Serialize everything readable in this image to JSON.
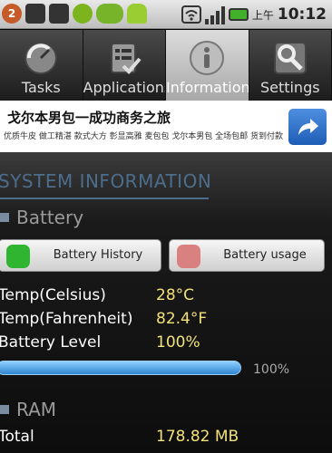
{
  "status_bar": {
    "badge_count": "2",
    "ampm": "上午",
    "time": "10:12",
    "icons": [
      "notification-count-icon",
      "usb-icon",
      "android-robot-icon",
      "refresh-icon",
      "pea-icon",
      "android-icon",
      "wifi-icon",
      "signal-icon",
      "battery-icon"
    ]
  },
  "tabs": [
    {
      "label": "Tasks",
      "icon": "tasks-icon",
      "active": false
    },
    {
      "label": "Applications",
      "icon": "applications-icon",
      "active": false
    },
    {
      "label": "Information",
      "icon": "info-icon",
      "active": true
    },
    {
      "label": "Settings",
      "icon": "settings-icon",
      "active": false
    }
  ],
  "ad": {
    "title": "戈尔本男包一成功商务之旅",
    "subtitle": "优质牛皮 做工精湛 款式大方 彰显高雅 麦包包 戈尔本男包 全场包邮 货到付款",
    "button_icon": "share-arrow-icon"
  },
  "system_info": {
    "title": "SYSTEM INFORMATION",
    "battery": {
      "section_label": "Battery",
      "history_button": "Battery History",
      "usage_button": "Battery usage",
      "rows": [
        {
          "label": "Temp(Celsius)",
          "value": "28°C"
        },
        {
          "label": "Temp(Fahrenheit)",
          "value": "82.4°F"
        },
        {
          "label": "Battery Level",
          "value": "100%"
        }
      ],
      "level_percent": 100,
      "level_text": "100%"
    },
    "ram": {
      "section_label": "RAM",
      "rows": [
        {
          "label": "Total",
          "value": "178.82 MB"
        }
      ]
    }
  },
  "colors": {
    "accent_blue": "#4c6d8c",
    "value_yellow": "#f2e27a",
    "progress_blue": "#3b9ae0",
    "history_green": "#2fb52f",
    "usage_red": "#d98080"
  }
}
